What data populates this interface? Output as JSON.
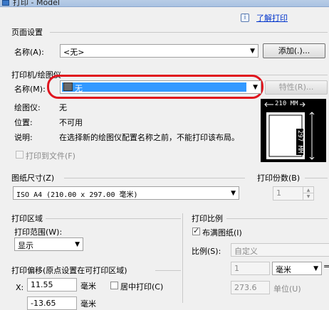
{
  "window": {
    "title": "打印 - Model"
  },
  "help": {
    "icon": "info-icon",
    "link": "了解打印"
  },
  "page_setup": {
    "group_label": "页面设置",
    "name_label": "名称(A):",
    "name_value": "<无>",
    "add_button": "添加(.)..."
  },
  "printer": {
    "group_label": "打印机/绘图仪",
    "name_label": "名称(M):",
    "name_value": "无",
    "properties_button": "特性(R)...",
    "plotter_label": "绘图仪:",
    "plotter_value": "无",
    "location_label": "位置:",
    "location_value": "不可用",
    "description_label": "说明:",
    "description_value": "在选择新的绘图仪配置名称之前，不能打印该布局。",
    "print_to_file": "打印到文件(F)",
    "preview_width": "210 MM",
    "preview_height": "297 MM"
  },
  "paper_size": {
    "group_label": "图纸尺寸(Z)",
    "value": "ISO A4 (210.00 x 297.00 毫米)"
  },
  "copies": {
    "group_label": "打印份数(B)",
    "value": "1"
  },
  "plot_area": {
    "group_label": "打印区域",
    "range_label": "打印范围(W):",
    "range_value": "显示"
  },
  "plot_offset": {
    "group_label": "打印偏移(原点设置在可打印区域)",
    "x_label": "X:",
    "x_value": "11.55",
    "x_unit": "毫米",
    "center_label": "居中打印(C)",
    "y_value": "-13.65",
    "y_unit": "毫米"
  },
  "plot_scale": {
    "group_label": "打印比例",
    "fit_label": "布满图纸(I)",
    "scale_label": "比例(S):",
    "scale_value": "自定义",
    "value1": "1",
    "unit_value": "毫米",
    "equals": "=",
    "value2": "273.6",
    "unit_label": "单位(U)"
  },
  "colors": {
    "highlight": "#3399ff",
    "annotation_red": "#e0141e",
    "preview_bg": "#000000"
  }
}
